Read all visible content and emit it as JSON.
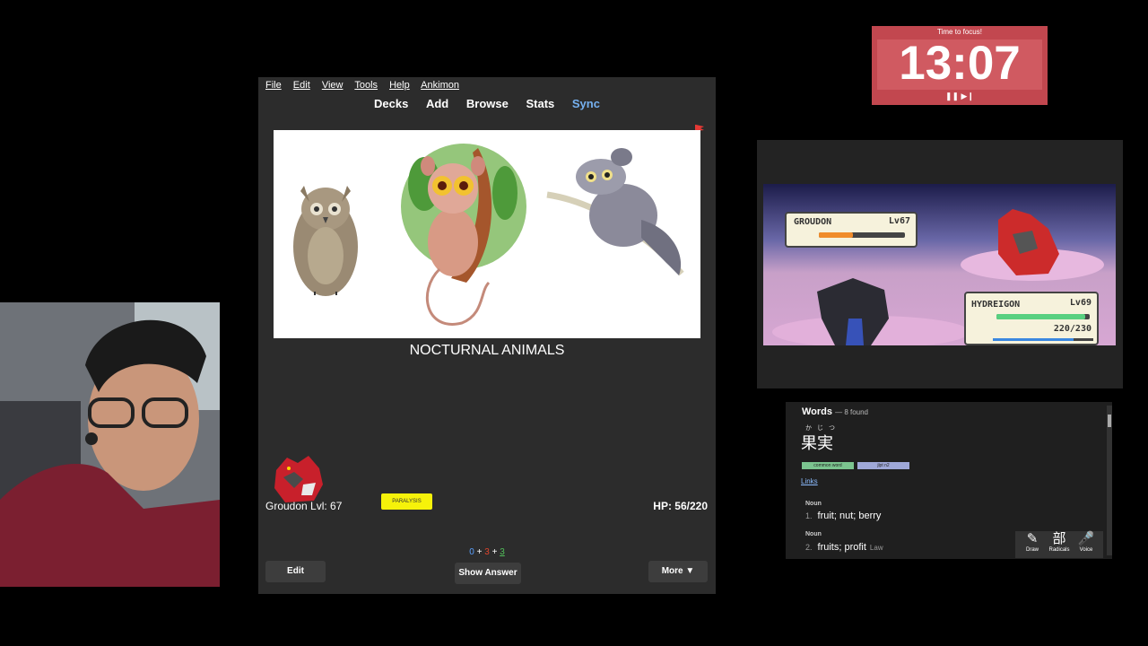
{
  "timer": {
    "title": "Time to focus!",
    "time": "13:07",
    "controls": "❚❚ ▶❙"
  },
  "anki": {
    "menu": [
      {
        "label": "File"
      },
      {
        "label": "Edit"
      },
      {
        "label": "View"
      },
      {
        "label": "Tools"
      },
      {
        "label": "Help"
      },
      {
        "label": "Ankimon"
      }
    ],
    "toolbar": {
      "decks": "Decks",
      "add": "Add",
      "browse": "Browse",
      "stats": "Stats",
      "sync": "Sync"
    },
    "card_title": "NOCTURNAL ANIMALS",
    "pokemon_status": "Groudon Lvl: 67",
    "condition": "PARALYSIS",
    "hp": "HP: 56/220",
    "counts": {
      "new": "0",
      "learning": "3",
      "review": "3",
      "sep": "+"
    },
    "buttons": {
      "edit": "Edit",
      "show_answer": "Show Answer",
      "more": "More ▼"
    },
    "colors": {
      "flag": "#e53935",
      "sync": "#76b1f0"
    }
  },
  "battle": {
    "enemy": {
      "name": "GROUDON",
      "level": "Lv67",
      "hp_fraction": 0.4
    },
    "player": {
      "name": "HYDREIGON",
      "level": "Lv69",
      "hp_text": "220/230",
      "hp_fraction": 0.95,
      "exp_fraction": 0.8
    }
  },
  "dictionary": {
    "title": "Words",
    "found": "— 8 found",
    "furigana": "かじつ",
    "kanji": "果実",
    "tags": [
      "common word",
      "jlpt n2"
    ],
    "links": "Links",
    "senses": [
      {
        "pos": "Noun",
        "num": "1.",
        "text": "fruit; nut; berry",
        "tag": ""
      },
      {
        "pos": "Noun",
        "num": "2.",
        "text": "fruits; profit",
        "tag": "Law"
      }
    ],
    "tools": [
      {
        "label": "Draw",
        "icon": "✎"
      },
      {
        "label": "Radicals",
        "icon": "部"
      },
      {
        "label": "Voice",
        "icon": "🎤"
      }
    ]
  }
}
